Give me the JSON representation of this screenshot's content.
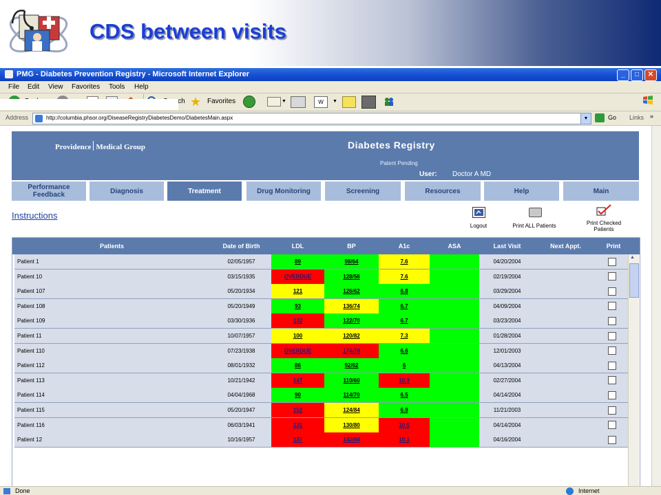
{
  "slide": {
    "title": "CDS between visits"
  },
  "browser": {
    "window_title": "PMG - Diabetes Prevention Registry - Microsoft Internet Explorer",
    "menu": [
      "File",
      "Edit",
      "View",
      "Favorites",
      "Tools",
      "Help"
    ],
    "toolbar": {
      "back": "Back",
      "search": "Search",
      "favorites": "Favorites"
    },
    "address_label": "Address",
    "url": "http://columbia.phsor.org/DiseaseRegistryDiabetesDemo/DiabetesMain.aspx",
    "go": "Go",
    "links": "Links",
    "status_left": "Done",
    "status_right": "Internet"
  },
  "page": {
    "brand_left": "Providence",
    "brand_right": "Medical Group",
    "registry_title": "Diabetes Registry",
    "patent": "Patent Pending",
    "user_label": "User:",
    "user_value": "Doctor A MD",
    "tabs": [
      {
        "label": "Performance Feedback",
        "active": false
      },
      {
        "label": "Diagnosis",
        "active": false
      },
      {
        "label": "Treatment",
        "active": true
      },
      {
        "label": "Drug Monitoring",
        "active": false
      },
      {
        "label": "Screening",
        "active": false
      },
      {
        "label": "Resources",
        "active": false
      },
      {
        "label": "Help",
        "active": false
      },
      {
        "label": "Main",
        "active": false
      }
    ],
    "instructions": "Instructions",
    "actions": {
      "logout": "Logout",
      "print_all": "Print ALL Patients",
      "print_checked": "Print Checked Patients"
    }
  },
  "table": {
    "headers": {
      "patients": "Patients",
      "dob": "Date of Birth",
      "ldl": "LDL",
      "bp": "BP",
      "a1c": "A1c",
      "asa": "ASA",
      "last_visit": "Last Visit",
      "next_appt": "Next Appt.",
      "print": "Print"
    },
    "colors": {
      "green": "#00ff00",
      "yellow": "#ffff00",
      "red": "#ff0000"
    },
    "rows": [
      {
        "name": "Patient 1",
        "dob": "02/05/1957",
        "ldl": "89",
        "ldl_c": "g",
        "bp": "98/64",
        "bp_c": "g",
        "a1c": "7.6",
        "a1c_c": "y",
        "last_visit": "04/20/2004"
      },
      {
        "name": "Patient 10",
        "dob": "03/15/1935",
        "ldl": "OVERDUE",
        "ldl_c": "r",
        "bp": "128/56",
        "bp_c": "g",
        "a1c": "7.6",
        "a1c_c": "y",
        "last_visit": "02/19/2004"
      },
      {
        "name": "Patient 107",
        "dob": "05/20/1934",
        "ldl": "121",
        "ldl_c": "y",
        "bp": "126/62",
        "bp_c": "g",
        "a1c": "6.8",
        "a1c_c": "g",
        "last_visit": "03/29/2004"
      },
      {
        "name": "Patient 108",
        "dob": "05/20/1949",
        "ldl": "93",
        "ldl_c": "g",
        "bp": "136/74",
        "bp_c": "y",
        "a1c": "6.7",
        "a1c_c": "g",
        "last_visit": "04/09/2004"
      },
      {
        "name": "Patient 109",
        "dob": "03/30/1936",
        "ldl": "132",
        "ldl_c": "r",
        "bp": "122/70",
        "bp_c": "g",
        "a1c": "6.7",
        "a1c_c": "g",
        "last_visit": "03/23/2004"
      },
      {
        "name": "Patient 11",
        "dob": "10/07/1957",
        "ldl": "100",
        "ldl_c": "y",
        "bp": "120/82",
        "bp_c": "y",
        "a1c": "7.3",
        "a1c_c": "y",
        "last_visit": "01/28/2004"
      },
      {
        "name": "Patient 110",
        "dob": "07/23/1938",
        "ldl": "OVERDUE",
        "ldl_c": "r",
        "bp": "174/78",
        "bp_c": "r",
        "a1c": "6.6",
        "a1c_c": "g",
        "last_visit": "12/01/2003"
      },
      {
        "name": "Patient 112",
        "dob": "08/01/1932",
        "ldl": "86",
        "ldl_c": "g",
        "bp": "92/62",
        "bp_c": "g",
        "a1c": "6",
        "a1c_c": "g",
        "last_visit": "04/13/2004"
      },
      {
        "name": "Patient 113",
        "dob": "10/21/1942",
        "ldl": "147",
        "ldl_c": "r",
        "bp": "110/60",
        "bp_c": "g",
        "a1c": "10.9",
        "a1c_c": "r",
        "last_visit": "02/27/2004"
      },
      {
        "name": "Patient 114",
        "dob": "04/04/1968",
        "ldl": "90",
        "ldl_c": "g",
        "bp": "114/70",
        "bp_c": "g",
        "a1c": "6.5",
        "a1c_c": "g",
        "last_visit": "04/14/2004"
      },
      {
        "name": "Patient 115",
        "dob": "05/20/1947",
        "ldl": "152",
        "ldl_c": "r",
        "bp": "124/84",
        "bp_c": "y",
        "a1c": "6.9",
        "a1c_c": "g",
        "last_visit": "11/21/2003"
      },
      {
        "name": "Patient 116",
        "dob": "06/03/1941",
        "ldl": "131",
        "ldl_c": "r",
        "bp": "130/80",
        "bp_c": "y",
        "a1c": "10.5",
        "a1c_c": "r",
        "last_visit": "04/14/2004"
      },
      {
        "name": "Patient 12",
        "dob": "10/16/1957",
        "ldl": "137",
        "ldl_c": "r",
        "bp": "142/84",
        "bp_c": "r",
        "a1c": "10.1",
        "a1c_c": "r",
        "last_visit": "04/16/2004"
      }
    ]
  }
}
